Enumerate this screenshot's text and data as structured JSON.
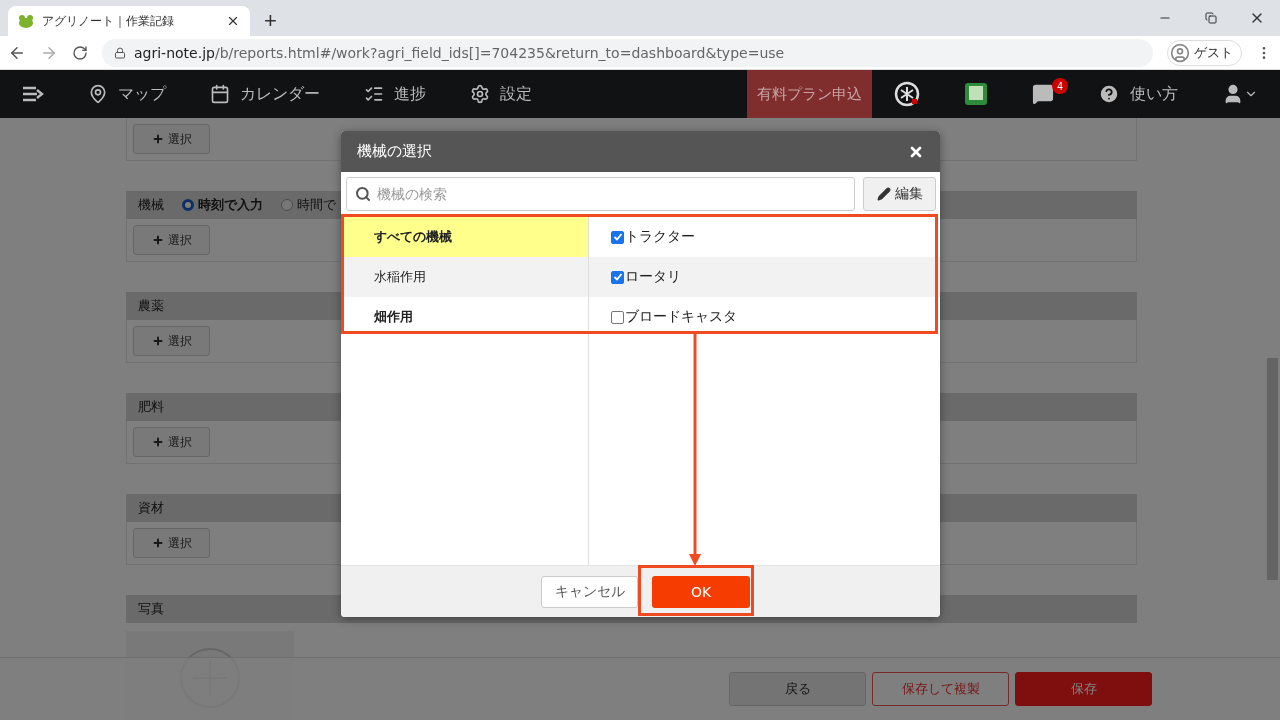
{
  "browser": {
    "tab_title": "アグリノート｜作業記録",
    "new_tab": "+",
    "url_host": "agri-note.jp",
    "url_path": "/b/reports.html#/work?agri_field_ids[]=704235&return_to=dashboard&type=use",
    "profile": "ゲスト"
  },
  "nav": {
    "items": [
      {
        "label": "マップ"
      },
      {
        "label": "カレンダー"
      },
      {
        "label": "進捗"
      },
      {
        "label": "設定"
      }
    ],
    "plan_button": "有料プラン申込",
    "message_count": "4",
    "help": "使い方"
  },
  "page": {
    "sections": [
      {
        "kind": "cut",
        "button": "選択"
      },
      {
        "kind": "select",
        "title": "機械",
        "radios": [
          {
            "label": "時刻で入力",
            "selected": true
          },
          {
            "label": "時間で",
            "selected": false
          }
        ],
        "button": "選択"
      },
      {
        "kind": "select",
        "title": "農薬",
        "button": "選択"
      },
      {
        "kind": "select",
        "title": "肥料",
        "button": "選択"
      },
      {
        "kind": "select",
        "title": "資材",
        "button": "選択"
      },
      {
        "kind": "photo",
        "title": "写真"
      }
    ],
    "footer_buttons": [
      {
        "label": "戻る",
        "kind": "default"
      },
      {
        "label": "保存して複製",
        "kind": "outline"
      },
      {
        "label": "保存",
        "kind": "primary"
      }
    ]
  },
  "modal": {
    "title": "機械の選択",
    "search": {
      "placeholder": "機械の検索"
    },
    "edit_button": "編集",
    "categories": [
      {
        "label": "すべての機械",
        "selected": true,
        "bold": true
      },
      {
        "label": "水稲作用",
        "selected": false,
        "bold": false
      },
      {
        "label": "畑作用",
        "selected": false,
        "bold": true
      }
    ],
    "machines": [
      {
        "label": "トラクター",
        "checked": true
      },
      {
        "label": "ロータリ",
        "checked": true
      },
      {
        "label": "ブロードキャスタ",
        "checked": false
      }
    ],
    "cancel_button": "キャンセル",
    "ok_button": "OK"
  }
}
